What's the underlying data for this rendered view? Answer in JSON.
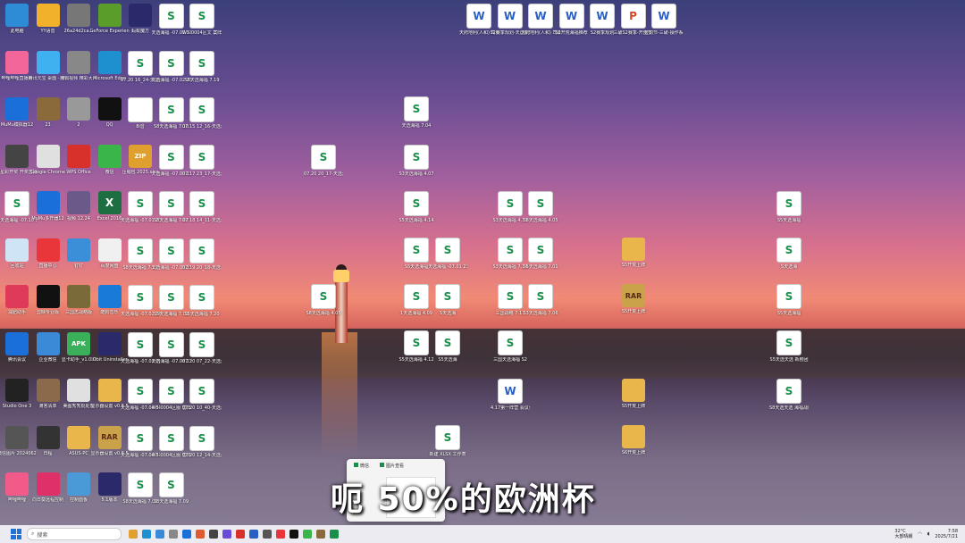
{
  "desktop_icons": [
    {
      "label": "此电脑",
      "type": "pc",
      "color": "#2e8bd6"
    },
    {
      "label": "YY语音",
      "type": "app",
      "color": "#f2b12a"
    },
    {
      "label": "26a24d2ca...",
      "type": "img",
      "color": "#777"
    },
    {
      "label": "GeForce Experience",
      "type": "app",
      "color": "#5a9d2a"
    },
    {
      "label": "蚂蚁魔方",
      "type": "app",
      "color": "#2a2a6a"
    },
    {
      "label": "天选海福 -07.05 23_...",
      "type": "sheet"
    },
    {
      "label": "W5-0004区文 案阵营内排行",
      "type": "sheet"
    },
    {
      "label": "哔哩哔哩直播姬",
      "type": "app",
      "color": "#f2669a"
    },
    {
      "label": "腾讯元宝 桌面 - 智能助手",
      "type": "app",
      "color": "#3fb0f0"
    },
    {
      "label": "腾讯视频 精彩大片",
      "type": "img",
      "color": "#888"
    },
    {
      "label": "Microsoft Edge",
      "type": "app",
      "color": "#1e8fcf"
    },
    {
      "label": "07.20 16_24-天选海福",
      "type": "sheet"
    },
    {
      "label": "天选海福 -07.02 23_...",
      "type": "sheet"
    },
    {
      "label": "S8天选海福 7.19",
      "type": "sheet"
    },
    {
      "label": "MuMu模拟器12",
      "type": "app",
      "color": "#1a6fd8"
    },
    {
      "label": "23",
      "type": "app",
      "color": "#8a6a3a"
    },
    {
      "label": "2",
      "type": "img",
      "color": "#999"
    },
    {
      "label": "QQ",
      "type": "app",
      "color": "#111"
    },
    {
      "label": "8i音",
      "type": "blank"
    },
    {
      "label": "S8天选海福 7.10",
      "type": "sheet"
    },
    {
      "label": "07.15 12_16-天选海福",
      "type": "sheet"
    },
    {
      "label": "7星彩开奖 开奖直播",
      "type": "app",
      "color": "#444"
    },
    {
      "label": "Google Chrome",
      "type": "app",
      "color": "#e0e0e0"
    },
    {
      "label": "WPS Office",
      "type": "app",
      "color": "#d8302a"
    },
    {
      "label": "微信",
      "type": "app",
      "color": "#39b54a"
    },
    {
      "label": "压缩包 2025.xlsx",
      "type": "zip",
      "color": "#e0a030"
    },
    {
      "label": "天选海福 -07.05 23_...",
      "type": "sheet"
    },
    {
      "label": "07.17 23_17-天选海福",
      "type": "sheet"
    },
    {
      "label": "S天选海福 -07.10 23_...",
      "type": "sheet"
    },
    {
      "label": "MuMu多开器12",
      "type": "app",
      "color": "#1a6fd8"
    },
    {
      "label": "视频 12.24",
      "type": "img",
      "color": "#6a5a8a"
    },
    {
      "label": "Excel 2016",
      "type": "excel"
    },
    {
      "label": "天选海福 -07.01 23_...",
      "type": "sheet"
    },
    {
      "label": "S8天选海福 7.07",
      "type": "sheet"
    },
    {
      "label": "07.18 14_11-天选海福",
      "type": "sheet"
    },
    {
      "label": "回收站",
      "type": "app",
      "color": "#cfe4f4"
    },
    {
      "label": "直播中心",
      "type": "app",
      "color": "#e8363a"
    },
    {
      "label": "钉钉",
      "type": "app",
      "color": "#3a8fd8"
    },
    {
      "label": "百度网盘",
      "type": "app",
      "color": "#f0f0f0"
    },
    {
      "label": "S8天选海福 7.12",
      "type": "sheet"
    },
    {
      "label": "天选海福 -07.03 23_...",
      "type": "sheet"
    },
    {
      "label": "07.19 20_18-天选海福",
      "type": "sheet"
    },
    {
      "label": "减肥助手",
      "type": "app",
      "color": "#e03a5a"
    },
    {
      "label": "剪映专业版",
      "type": "app",
      "color": "#111"
    },
    {
      "label": "三国志战略版",
      "type": "img",
      "color": "#7a6a3a"
    },
    {
      "label": "酷狗音乐",
      "type": "app",
      "color": "#1a7ad8"
    },
    {
      "label": "天选海福 -07.02 16_...",
      "type": "sheet"
    },
    {
      "label": "S5天选海福 7.03",
      "type": "sheet"
    },
    {
      "label": "S5天选海福 7.20",
      "type": "sheet"
    },
    {
      "label": "腾讯会议",
      "type": "app",
      "color": "#1a6fd8"
    },
    {
      "label": "企业微信",
      "type": "app",
      "color": "#3a8ad8"
    },
    {
      "label": "显卡助手_v1.0.0",
      "type": "apk",
      "color": "#3ab05a"
    },
    {
      "label": "IObit Uninstaller",
      "type": "app",
      "color": "#2a2a6a"
    },
    {
      "label": "天选海福 -07.02 09_...",
      "type": "sheet"
    },
    {
      "label": "天选海福 -07.08 23_...",
      "type": "sheet"
    },
    {
      "label": "07.20 07_22-天选海福",
      "type": "sheet"
    },
    {
      "label": "Studio One 3",
      "type": "app",
      "color": "#222"
    },
    {
      "label": "滴答清单",
      "type": "app",
      "color": "#8a6a4a"
    },
    {
      "label": "美图秀秀批处理",
      "type": "app",
      "color": "#e0e0e0"
    },
    {
      "label": "显示器设置 v0.6.5",
      "type": "folder"
    },
    {
      "label": "天选海福 -07.04 00_...",
      "type": "sheet"
    },
    {
      "label": "W5-0004区服 营阵营内排行",
      "type": "sheet"
    },
    {
      "label": "07.20 10_40-天选海福",
      "type": "sheet"
    },
    {
      "label": "微信图片 20240626...",
      "type": "img",
      "color": "#555"
    },
    {
      "label": "日程",
      "type": "img",
      "color": "#333"
    },
    {
      "label": "ASUS-PC",
      "type": "folder"
    },
    {
      "label": "显示器设置 v0.6.5",
      "type": "rar"
    },
    {
      "label": "天选海福 -07.04 23_...",
      "type": "sheet"
    },
    {
      "label": "W5-0004区服 营阵营内排行",
      "type": "sheet"
    },
    {
      "label": "07.20 12_14-天选海福",
      "type": "sheet"
    },
    {
      "label": "哔哩哔哩",
      "type": "app",
      "color": "#f25a8a"
    },
    {
      "label": "向日葵远程控制",
      "type": "app",
      "color": "#e0306a"
    },
    {
      "label": "控制面板",
      "type": "app",
      "color": "#4a9ad8"
    },
    {
      "label": "5.1版本",
      "type": "app",
      "color": "#2a2a6a"
    },
    {
      "label": "S8天选海福 7.05",
      "type": "sheet"
    },
    {
      "label": "S8天选海福 7.09",
      "type": "sheet"
    }
  ],
  "top_word_icons": [
    {
      "label": "天府地利(人和) 司南三魂一...",
      "type": "word"
    },
    {
      "label": "S2赛季规划-天选新剑",
      "type": "word"
    },
    {
      "label": "天府地利(人和) 司南三魂之...",
      "type": "word"
    },
    {
      "label": "S2开荒海福推荐",
      "type": "word"
    },
    {
      "label": "S2赛季规划",
      "type": "word"
    },
    {
      "label": "三破S2赛季-开荒节奏及...",
      "type": "ppt"
    },
    {
      "label": "显影节-三破-操作系统(1)",
      "type": "word"
    }
  ],
  "scattered_icons": [
    {
      "label": "天选海福 7.04",
      "type": "sheet"
    },
    {
      "label": "07.20 20_17-天选海福",
      "type": "sheet"
    },
    {
      "label": "S3天选海福 4.07",
      "type": "sheet"
    },
    {
      "label": "S5天选海福 4.14",
      "type": "sheet"
    },
    {
      "label": "S3天选海福 4.10",
      "type": "sheet"
    },
    {
      "label": "S8天选海福 4.05",
      "type": "sheet"
    },
    {
      "label": "S5天选海福",
      "type": "sheet"
    },
    {
      "label": "天选海福 -07.01 23_...",
      "type": "sheet"
    },
    {
      "label": "S3天选海福 7.14",
      "type": "sheet"
    },
    {
      "label": "S5天选海福 7.01",
      "type": "sheet"
    },
    {
      "label": "S8天选海福 4.05",
      "type": "sheet"
    },
    {
      "label": "1天选海福 4.09",
      "type": "sheet"
    },
    {
      "label": "S天选海",
      "type": "sheet"
    },
    {
      "label": "三国战略 7.17",
      "type": "sheet"
    },
    {
      "label": "S3天选海福 7.06",
      "type": "sheet"
    },
    {
      "label": "S5天选海福 4.12",
      "type": "sheet"
    },
    {
      "label": "S5天选海",
      "type": "sheet"
    },
    {
      "label": "三国天选海福 S2",
      "type": "sheet"
    },
    {
      "label": "4.17第一阵营 会议记录",
      "type": "word"
    },
    {
      "label": "新建 XLSX 工作表",
      "type": "sheet"
    },
    {
      "label": "S5开荒上牌",
      "type": "folder"
    },
    {
      "label": "S5开荒上牌",
      "type": "rar"
    },
    {
      "label": "S5开荒上牌",
      "type": "folder"
    },
    {
      "label": "S6开荒上牌",
      "type": "folder"
    },
    {
      "label": "S5天选海福",
      "type": "sheet"
    },
    {
      "label": "S天选海",
      "type": "sheet"
    },
    {
      "label": "S5天选海福",
      "type": "sheet"
    },
    {
      "label": "S5天选天选 新剧团",
      "type": "sheet"
    },
    {
      "label": "S8天选天选 海福战队",
      "type": "sheet"
    }
  ],
  "subtitle": "呃  50%的欧洲杯",
  "popup": {
    "tab1": "微信",
    "tab2": "图片查看"
  },
  "taskbar": {
    "search_placeholder": "搜索",
    "weather_temp": "32°C",
    "weather_desc": "大部晴朗",
    "time": "7:58",
    "date": "2025/7/21"
  },
  "colors": {
    "accent": "#1f73d8",
    "sheet_green": "#1a8f4a",
    "word_blue": "#2a5fc4"
  }
}
